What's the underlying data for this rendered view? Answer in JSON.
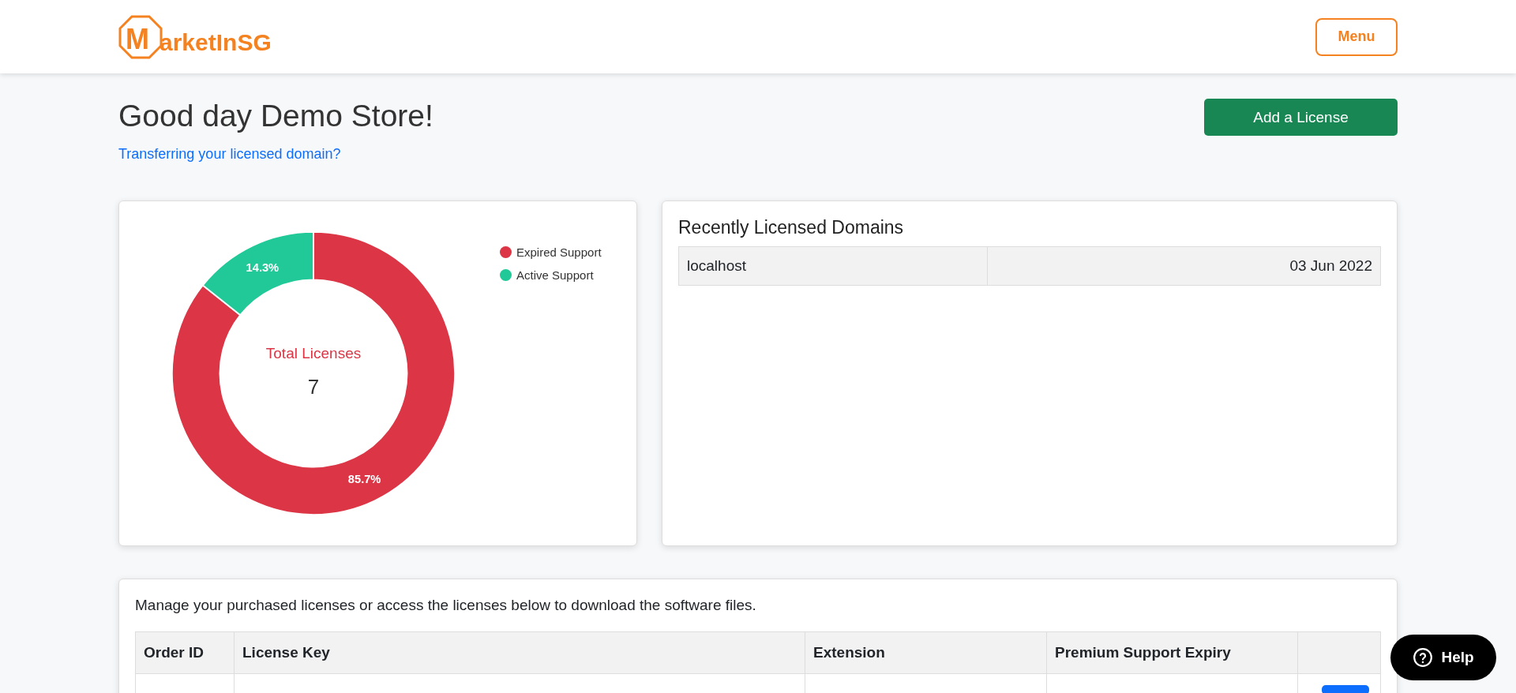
{
  "header": {
    "logo_initial": "M",
    "logo_rest": "arketInSG",
    "menu_button": "Menu"
  },
  "greeting": {
    "title": "Good day Demo Store!",
    "link": "Transferring your licensed domain?",
    "button": "Add a License"
  },
  "license_chart": {
    "center_label": "Total Licenses",
    "center_value": "7",
    "chart_data": {
      "type": "donut",
      "categories": [
        "Expired Support",
        "Active Support"
      ],
      "values": [
        85.7,
        14.3
      ],
      "colors": [
        "#dc3545",
        "#20c997"
      ],
      "value_labels": [
        "85.7%",
        "14.3%"
      ]
    }
  },
  "recent_domains": {
    "title": "Recently Licensed Domains",
    "rows": [
      {
        "domain": "localhost",
        "date": "03 Jun 2022"
      }
    ]
  },
  "licenses": {
    "intro": "Manage your purchased licenses or access the licenses below to download the software files.",
    "columns": [
      "Order ID",
      "License Key",
      "Extension",
      "Premium Support Expiry"
    ]
  },
  "help_button": "Help"
}
